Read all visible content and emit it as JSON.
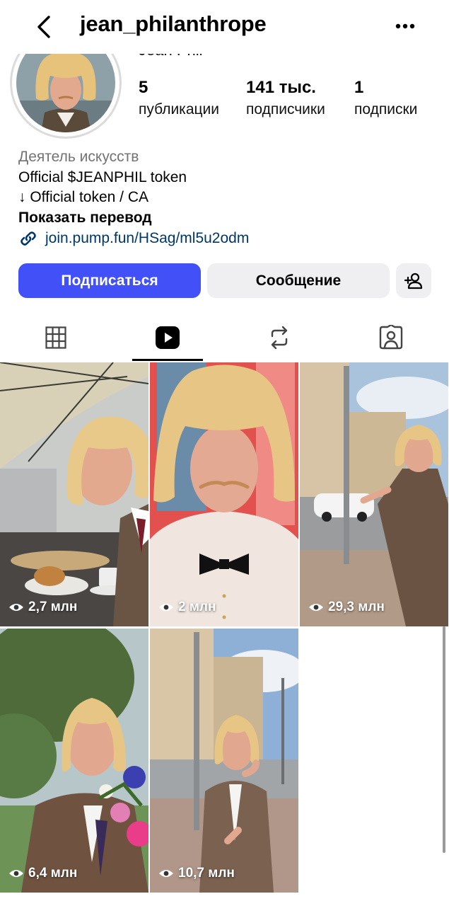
{
  "header": {
    "username": "jean_philanthrope"
  },
  "profile": {
    "display_name": "Jean Phil",
    "stats": [
      {
        "value": "5",
        "label": "публикации"
      },
      {
        "value": "141 тыс.",
        "label": "подписчики"
      },
      {
        "value": "1",
        "label": "подписки"
      }
    ],
    "bio": {
      "category": "Деятель искусств",
      "line1": "Official $JEANPHIL token",
      "line2": "↓ Official token / CA",
      "translate": "Показать перевод",
      "link": "join.pump.fun/HSag/ml5u2odm"
    }
  },
  "actions": {
    "follow": "Подписаться",
    "message": "Сообщение"
  },
  "tabs": [
    "grid-icon",
    "reels-icon",
    "repost-icon",
    "tagged-icon"
  ],
  "active_tab": "reels-icon",
  "reels": [
    {
      "views": "2,7 млн"
    },
    {
      "views": "2 млн"
    },
    {
      "views": "29,3 млн"
    },
    {
      "views": "6,4 млн"
    },
    {
      "views": "10,7 млн"
    }
  ],
  "colors": {
    "accent": "#4150f7",
    "link": "#00376b",
    "secondary_button": "#efeff2",
    "muted": "#737373"
  }
}
